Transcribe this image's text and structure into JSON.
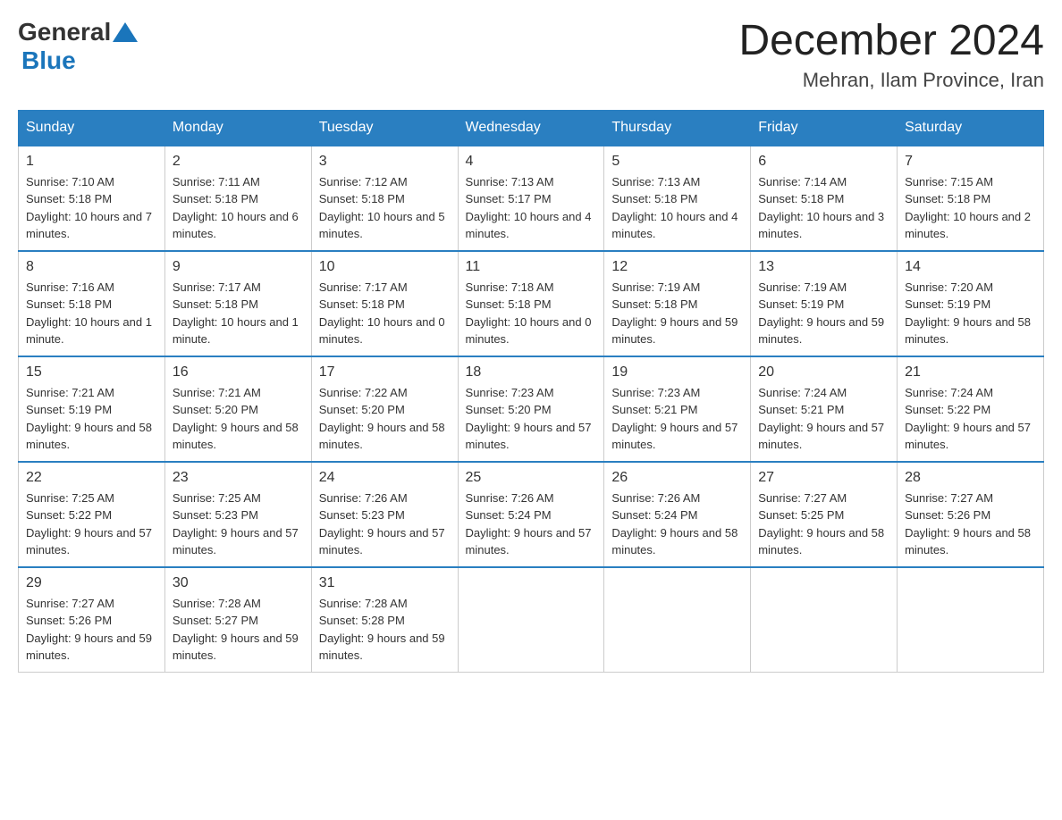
{
  "header": {
    "logo_general": "General",
    "logo_blue": "Blue",
    "month_title": "December 2024",
    "location": "Mehran, Ilam Province, Iran"
  },
  "days_of_week": [
    "Sunday",
    "Monday",
    "Tuesday",
    "Wednesday",
    "Thursday",
    "Friday",
    "Saturday"
  ],
  "weeks": [
    [
      {
        "day": "1",
        "sunrise": "7:10 AM",
        "sunset": "5:18 PM",
        "daylight": "10 hours and 7 minutes."
      },
      {
        "day": "2",
        "sunrise": "7:11 AM",
        "sunset": "5:18 PM",
        "daylight": "10 hours and 6 minutes."
      },
      {
        "day": "3",
        "sunrise": "7:12 AM",
        "sunset": "5:18 PM",
        "daylight": "10 hours and 5 minutes."
      },
      {
        "day": "4",
        "sunrise": "7:13 AM",
        "sunset": "5:17 PM",
        "daylight": "10 hours and 4 minutes."
      },
      {
        "day": "5",
        "sunrise": "7:13 AM",
        "sunset": "5:18 PM",
        "daylight": "10 hours and 4 minutes."
      },
      {
        "day": "6",
        "sunrise": "7:14 AM",
        "sunset": "5:18 PM",
        "daylight": "10 hours and 3 minutes."
      },
      {
        "day": "7",
        "sunrise": "7:15 AM",
        "sunset": "5:18 PM",
        "daylight": "10 hours and 2 minutes."
      }
    ],
    [
      {
        "day": "8",
        "sunrise": "7:16 AM",
        "sunset": "5:18 PM",
        "daylight": "10 hours and 1 minute."
      },
      {
        "day": "9",
        "sunrise": "7:17 AM",
        "sunset": "5:18 PM",
        "daylight": "10 hours and 1 minute."
      },
      {
        "day": "10",
        "sunrise": "7:17 AM",
        "sunset": "5:18 PM",
        "daylight": "10 hours and 0 minutes."
      },
      {
        "day": "11",
        "sunrise": "7:18 AM",
        "sunset": "5:18 PM",
        "daylight": "10 hours and 0 minutes."
      },
      {
        "day": "12",
        "sunrise": "7:19 AM",
        "sunset": "5:18 PM",
        "daylight": "9 hours and 59 minutes."
      },
      {
        "day": "13",
        "sunrise": "7:19 AM",
        "sunset": "5:19 PM",
        "daylight": "9 hours and 59 minutes."
      },
      {
        "day": "14",
        "sunrise": "7:20 AM",
        "sunset": "5:19 PM",
        "daylight": "9 hours and 58 minutes."
      }
    ],
    [
      {
        "day": "15",
        "sunrise": "7:21 AM",
        "sunset": "5:19 PM",
        "daylight": "9 hours and 58 minutes."
      },
      {
        "day": "16",
        "sunrise": "7:21 AM",
        "sunset": "5:20 PM",
        "daylight": "9 hours and 58 minutes."
      },
      {
        "day": "17",
        "sunrise": "7:22 AM",
        "sunset": "5:20 PM",
        "daylight": "9 hours and 58 minutes."
      },
      {
        "day": "18",
        "sunrise": "7:23 AM",
        "sunset": "5:20 PM",
        "daylight": "9 hours and 57 minutes."
      },
      {
        "day": "19",
        "sunrise": "7:23 AM",
        "sunset": "5:21 PM",
        "daylight": "9 hours and 57 minutes."
      },
      {
        "day": "20",
        "sunrise": "7:24 AM",
        "sunset": "5:21 PM",
        "daylight": "9 hours and 57 minutes."
      },
      {
        "day": "21",
        "sunrise": "7:24 AM",
        "sunset": "5:22 PM",
        "daylight": "9 hours and 57 minutes."
      }
    ],
    [
      {
        "day": "22",
        "sunrise": "7:25 AM",
        "sunset": "5:22 PM",
        "daylight": "9 hours and 57 minutes."
      },
      {
        "day": "23",
        "sunrise": "7:25 AM",
        "sunset": "5:23 PM",
        "daylight": "9 hours and 57 minutes."
      },
      {
        "day": "24",
        "sunrise": "7:26 AM",
        "sunset": "5:23 PM",
        "daylight": "9 hours and 57 minutes."
      },
      {
        "day": "25",
        "sunrise": "7:26 AM",
        "sunset": "5:24 PM",
        "daylight": "9 hours and 57 minutes."
      },
      {
        "day": "26",
        "sunrise": "7:26 AM",
        "sunset": "5:24 PM",
        "daylight": "9 hours and 58 minutes."
      },
      {
        "day": "27",
        "sunrise": "7:27 AM",
        "sunset": "5:25 PM",
        "daylight": "9 hours and 58 minutes."
      },
      {
        "day": "28",
        "sunrise": "7:27 AM",
        "sunset": "5:26 PM",
        "daylight": "9 hours and 58 minutes."
      }
    ],
    [
      {
        "day": "29",
        "sunrise": "7:27 AM",
        "sunset": "5:26 PM",
        "daylight": "9 hours and 59 minutes."
      },
      {
        "day": "30",
        "sunrise": "7:28 AM",
        "sunset": "5:27 PM",
        "daylight": "9 hours and 59 minutes."
      },
      {
        "day": "31",
        "sunrise": "7:28 AM",
        "sunset": "5:28 PM",
        "daylight": "9 hours and 59 minutes."
      },
      null,
      null,
      null,
      null
    ]
  ]
}
